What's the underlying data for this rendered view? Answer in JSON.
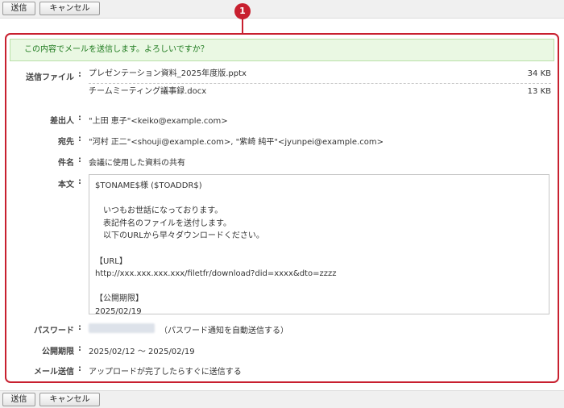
{
  "toolbar": {
    "send_label": "送信",
    "cancel_label": "キャンセル"
  },
  "marker_number": "1",
  "confirm_message": "この内容でメールを送信します。よろしいですか？",
  "fields": {
    "files_label": "送信ファイル",
    "files": [
      {
        "name": "プレゼンテーション資料_2025年度版.pptx",
        "size": "34 KB"
      },
      {
        "name": "チームミーティング議事録.docx",
        "size": "13 KB"
      }
    ],
    "sender_label": "差出人",
    "sender_value": "\"上田 恵子\"<keiko@example.com>",
    "to_label": "宛先",
    "to_value": "\"河村 正二\"<shouji@example.com>, \"紫崎 純平\"<jyunpei@example.com>",
    "subject_label": "件名",
    "subject_value": "会議に使用した資料の共有",
    "body_label": "本文",
    "body_text": "$TONAME$様 ($TOADDR$)\n\n　いつもお世話になっております。\n　表記件名のファイルを送付します。\n　以下のURLから早々ダウンロードください。\n\n【URL】\nhttp://xxx.xxx.xxx.xxx/filetfr/download?did=xxxx&dto=zzzz\n\n【公開期限】\n2025/02/19",
    "password_label": "パスワード",
    "password_note": "（パスワード通知を自動送信する）",
    "period_label": "公開期限",
    "period_value": "2025/02/12 ～ 2025/02/19",
    "mail_send_label": "メール送信",
    "mail_send_value": "アップロードが完了したらすぐに送信する"
  },
  "colors": {
    "highlight": "#c8202f",
    "confirm_bg": "#eaf8e3",
    "confirm_text": "#1e7a1e"
  }
}
